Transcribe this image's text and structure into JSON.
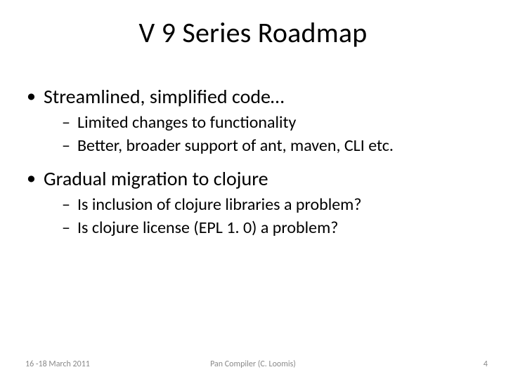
{
  "title": "V 9 Series Roadmap",
  "bullets": [
    {
      "text": "Streamlined, simplified code…",
      "children": [
        "Limited changes to functionality",
        "Better, broader support of ant, maven, CLI etc."
      ]
    },
    {
      "text": "Gradual migration to clojure",
      "children": [
        "Is inclusion of clojure libraries a problem?",
        "Is clojure license (EPL 1. 0) a problem?"
      ]
    }
  ],
  "footer": {
    "left": "16 -18 March 2011",
    "center": "Pan Compiler (C. Loomis)",
    "right": "4"
  }
}
